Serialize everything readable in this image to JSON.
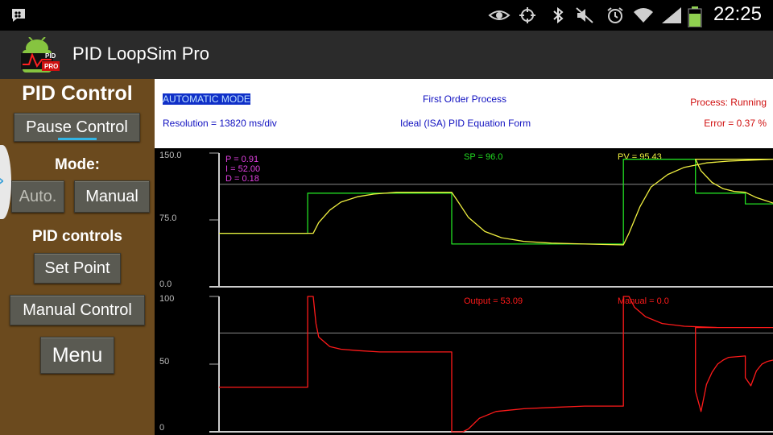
{
  "status_bar": {
    "time": "22:25",
    "icons": [
      "blackberry-messenger-icon",
      "eye-icon",
      "gps-icon",
      "bluetooth-icon",
      "mute-icon",
      "alarm-icon",
      "wifi-icon",
      "signal-icon",
      "battery-icon"
    ]
  },
  "app": {
    "title": "PID LoopSim Pro",
    "logo_text_top": "PID",
    "logo_text_badge": "PRO"
  },
  "sidebar": {
    "heading": "PID Control",
    "pause_label": "Pause Control",
    "mode_heading": "Mode:",
    "auto_label": "Auto.",
    "manual_label": "Manual",
    "controls_heading": "PID controls",
    "set_point_label": "Set Point",
    "manual_control_label": "Manual Control",
    "menu_label": "Menu"
  },
  "info": {
    "mode": "AUTOMATIC MODE",
    "process_type": "First Order Process",
    "process_state": "Process: Running",
    "resolution": "Resolution = 13820 ms/div",
    "equation": "Ideal (ISA) PID Equation Form",
    "error": "Error = 0.37 %"
  },
  "colors": {
    "setpoint": "#22dd22",
    "pv": "#f0f040",
    "output": "#ff1a1a",
    "pid_params": "#e040e0",
    "info_blue": "#1010c0",
    "info_red": "#d01010",
    "sidebar_bg": "#6b4a1e"
  },
  "chart_data": [
    {
      "type": "line",
      "y_ticks": [
        "150.0",
        "75.0",
        "0.0"
      ],
      "ylim": [
        0,
        150
      ],
      "xlim": [
        0,
        100
      ],
      "reference_line": 115,
      "params": {
        "p": "P = 0.91",
        "i": "I = 52.00",
        "d": "D = 0.18"
      },
      "readouts": {
        "sp": "SP = 96.0",
        "pv": "PV = 95.43"
      },
      "series": [
        {
          "key": "sp",
          "x": [
            0,
            16,
            16,
            42,
            42,
            73,
            73,
            86,
            86,
            95,
            95,
            100
          ],
          "y": [
            60,
            60,
            105,
            105,
            48,
            48,
            143,
            143,
            105,
            105,
            93,
            93
          ]
        },
        {
          "key": "pv",
          "x": [
            0,
            17,
            18,
            20,
            22,
            25,
            28,
            32,
            36,
            42,
            43,
            45,
            48,
            51,
            55,
            60,
            66,
            73,
            74,
            76,
            78,
            81,
            84,
            88,
            92,
            96,
            100,
            86,
            87,
            89,
            91,
            93,
            95,
            97,
            100
          ],
          "y": [
            60,
            60,
            72,
            86,
            95,
            101,
            104,
            106,
            106,
            106,
            97,
            78,
            62,
            55,
            51,
            49,
            48,
            47,
            60,
            90,
            112,
            126,
            134,
            139,
            141,
            142,
            143,
            143,
            130,
            117,
            110,
            107,
            106,
            100,
            94
          ]
        }
      ]
    },
    {
      "type": "line",
      "y_ticks": [
        "100",
        "50",
        "0"
      ],
      "ylim": [
        0,
        100
      ],
      "xlim": [
        0,
        100
      ],
      "reference_line": 73,
      "readouts": {
        "output": "Output = 53.09",
        "manual": "Manual = 0.0"
      },
      "series": [
        {
          "key": "output",
          "x": [
            0,
            16,
            16,
            17,
            17.5,
            18,
            20,
            22,
            25,
            29,
            35,
            42,
            42,
            43,
            44,
            45,
            47,
            50,
            55,
            60,
            66,
            73,
            73,
            74,
            75,
            77,
            80,
            84,
            90,
            100,
            100,
            86,
            86,
            87,
            88,
            89,
            90,
            91,
            92,
            95,
            95,
            96,
            97,
            98,
            99,
            100
          ],
          "y": [
            33,
            33,
            100,
            100,
            80,
            70,
            63,
            61,
            60,
            59,
            59,
            59,
            0,
            0,
            0,
            2,
            10,
            15,
            17,
            18,
            19,
            19,
            100,
            100,
            92,
            85,
            80,
            78,
            77,
            77,
            77,
            77,
            30,
            15,
            35,
            44,
            50,
            53,
            55,
            56,
            40,
            34,
            45,
            50,
            52,
            53
          ]
        }
      ]
    }
  ]
}
